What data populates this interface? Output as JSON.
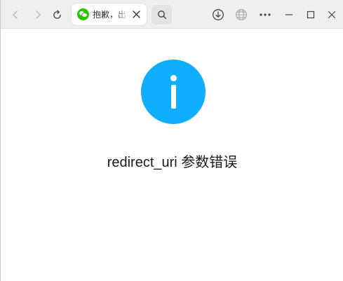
{
  "browser": {
    "tab": {
      "title": "抱歉，出错了",
      "favicon": "wechat-icon"
    },
    "toolbar": {
      "back": "back-arrow-icon",
      "forward": "forward-arrow-icon",
      "reload": "reload-icon",
      "search": "search-icon",
      "download": "download-icon",
      "globe": "globe-icon",
      "more": "more-icon"
    },
    "window_controls": [
      "minimize",
      "maximize",
      "close"
    ]
  },
  "page": {
    "icon": "info-icon",
    "icon_color": "#10aeff",
    "message": "redirect_uri 参数错误"
  }
}
